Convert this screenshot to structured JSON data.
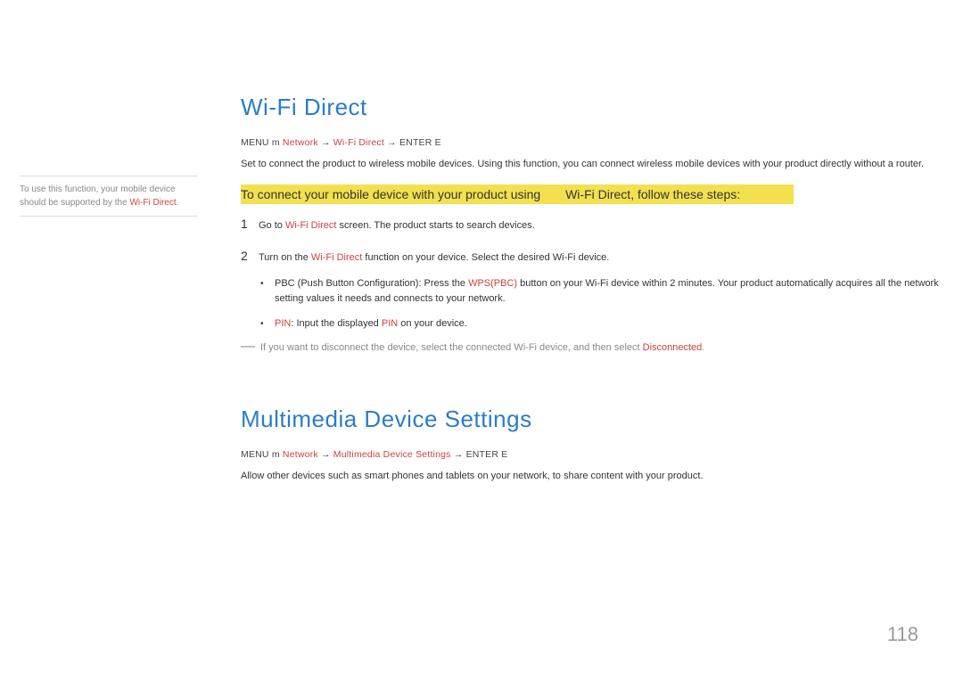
{
  "sidebar": {
    "note_part1": "To use this function, your mobile device should be supported by the ",
    "note_wifi": "Wi-Fi Direct",
    "note_part2": "."
  },
  "section1": {
    "heading": "Wi-Fi Direct",
    "menu_path": {
      "menu": "MENU",
      "icon": "m",
      "network": "Network",
      "arrow1": " → ",
      "wifi_direct": "Wi-Fi Direct",
      "arrow2": " → ",
      "enter": "ENTER",
      "enter_icon": "E"
    },
    "description": "Set to connect the product to wireless mobile devices. Using this function, you can connect wireless mobile devices with your product directly without a router.",
    "banner_part1": "To connect your mobile device with your product using ",
    "banner_wifi": "Wi-Fi Direct",
    "banner_part2": ", follow these steps:",
    "steps": [
      {
        "number": "1",
        "text_part1": "Go to ",
        "text_red": "Wi-Fi Direct",
        "text_part2": " screen. The product starts to search devices."
      },
      {
        "number": "2",
        "text_part1": "Turn on the ",
        "text_red": "Wi-Fi Direct",
        "text_part2": " function on your device. Select the desired Wi-Fi device."
      }
    ],
    "sub_bullets": [
      {
        "text_part1": "PBC (Push Button Configuration): Press the ",
        "text_red": "WPS(PBC)",
        "text_part2": " button on your Wi-Fi device within 2 minutes. Your product automatically acquires all the network setting values it needs and connects to your network."
      },
      {
        "text_red1": "PIN",
        "text_part1": ": Input the displayed ",
        "text_red2": "PIN",
        "text_part2": " on your device."
      }
    ],
    "note": {
      "part1": "If you want to disconnect the device, select the connected Wi-Fi device, and then select ",
      "red": "Disconnected",
      "part2": "."
    }
  },
  "section2": {
    "heading": "Multimedia  Device  Settings",
    "menu_path": {
      "menu": "MENU",
      "icon": "m",
      "network": "Network",
      "arrow1": " → ",
      "mds": "Multimedia Device Settings",
      "arrow2": " → ",
      "enter": "ENTER",
      "enter_icon": "E"
    },
    "description": "Allow other devices such as smart phones and tablets on your network, to share content with your product."
  },
  "page_number": "118"
}
